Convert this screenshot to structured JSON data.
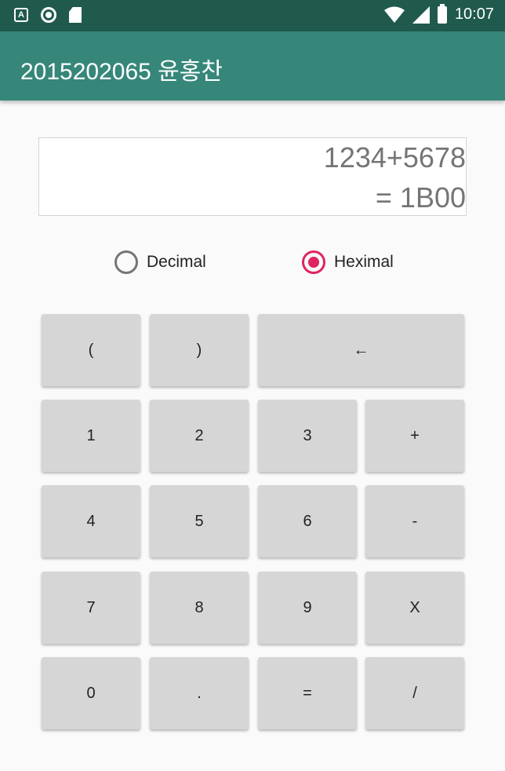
{
  "status_bar": {
    "time": "10:07",
    "left_icons": [
      "a-notification-icon",
      "circle-notification-icon",
      "sd-card-icon"
    ],
    "right_icons": [
      "wifi-icon",
      "signal-icon",
      "battery-icon"
    ]
  },
  "app_bar": {
    "title": "2015202065 윤홍찬",
    "color": "#36877a"
  },
  "display": {
    "expression": "1234+5678",
    "result": "= 1B00"
  },
  "radix": {
    "options": [
      {
        "label": "Decimal",
        "checked": false
      },
      {
        "label": "Heximal",
        "checked": true
      }
    ],
    "accent": "#e0245e"
  },
  "keypad": {
    "rows": [
      [
        "(",
        ")",
        "←"
      ],
      [
        "1",
        "2",
        "3",
        "+"
      ],
      [
        "4",
        "5",
        "6",
        "-"
      ],
      [
        "7",
        "8",
        "9",
        "X"
      ],
      [
        "0",
        ".",
        "=",
        "/"
      ]
    ]
  }
}
